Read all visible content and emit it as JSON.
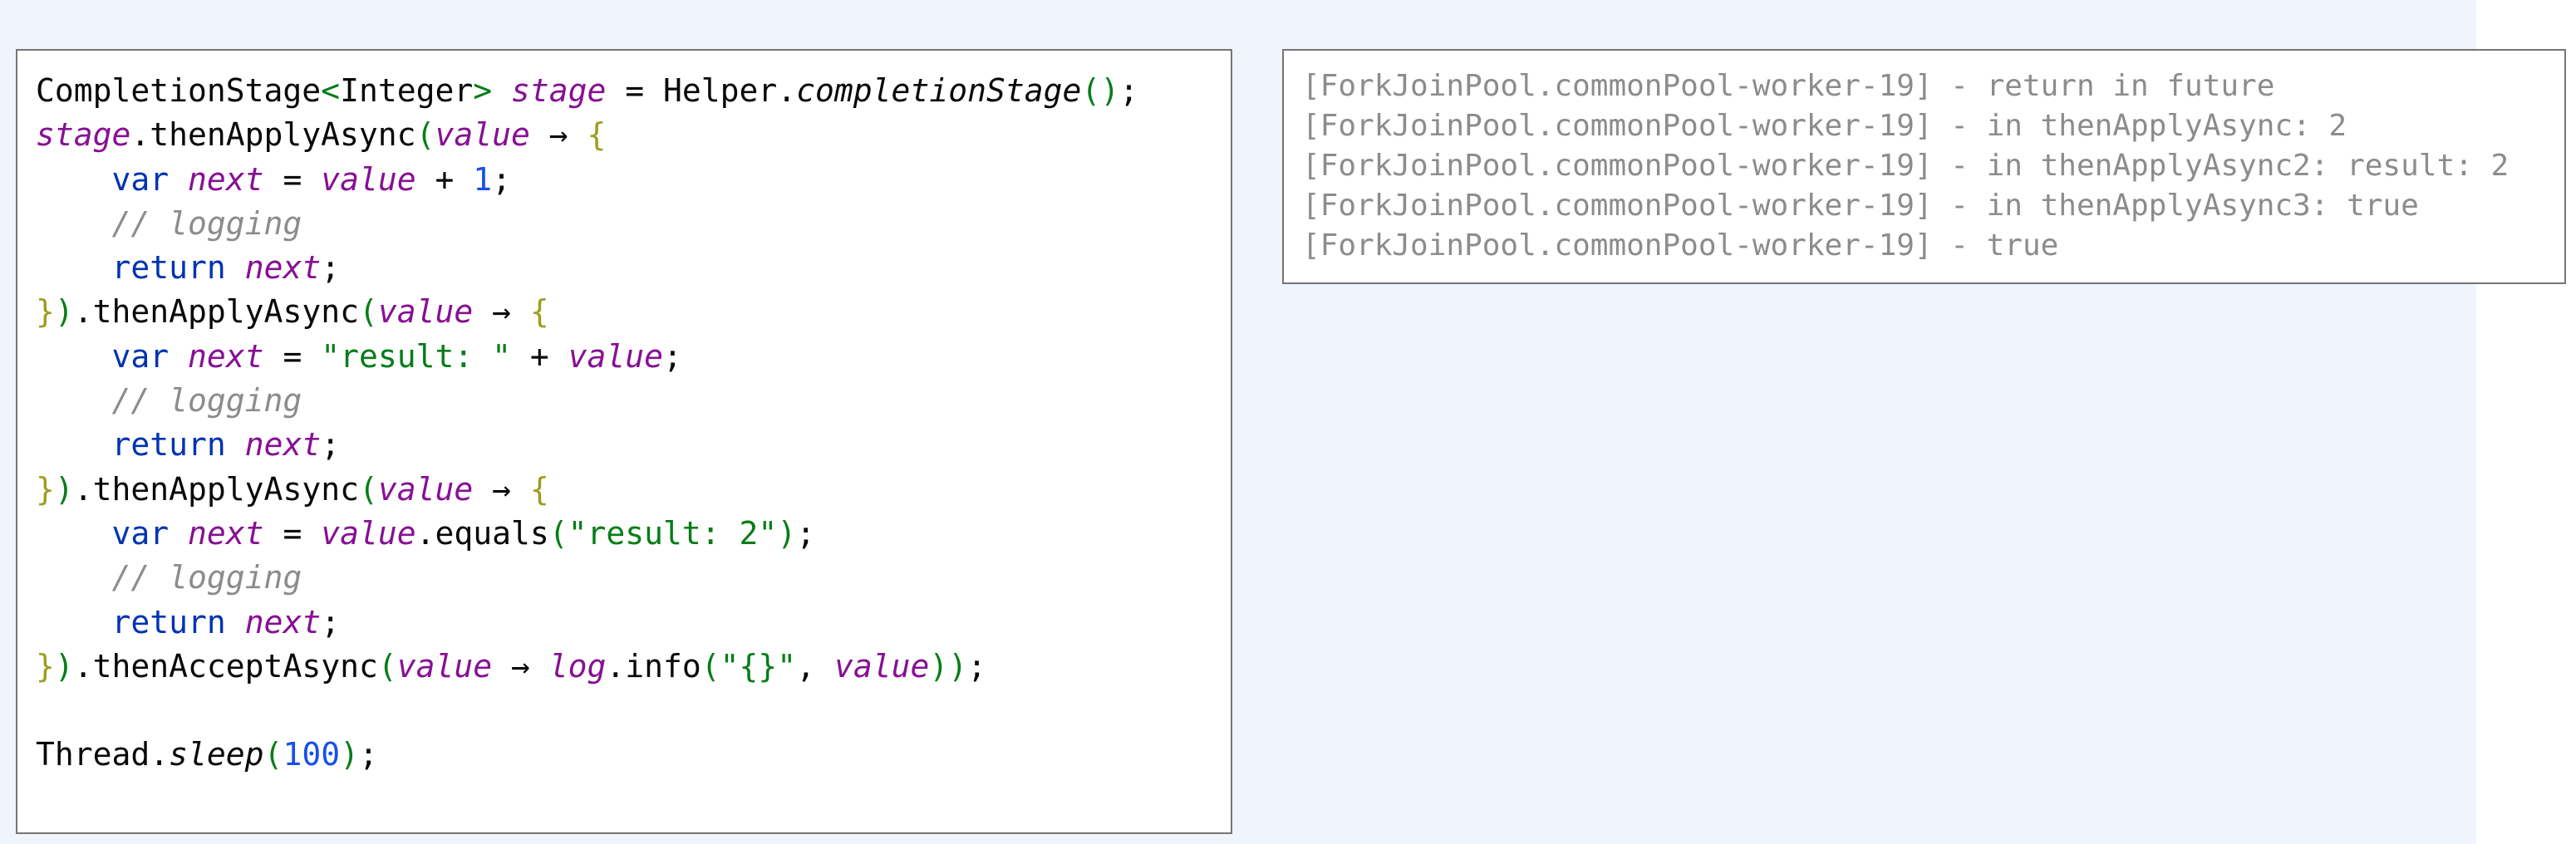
{
  "code": {
    "lines": [
      [
        {
          "t": "CompletionStage",
          "c": "plain"
        },
        {
          "t": "<",
          "c": "gen"
        },
        {
          "t": "Integer",
          "c": "plain"
        },
        {
          "t": ">",
          "c": "gen"
        },
        {
          "t": " ",
          "c": "plain"
        },
        {
          "t": "stage",
          "c": "var"
        },
        {
          "t": " = Helper.",
          "c": "plain"
        },
        {
          "t": "completionStage",
          "c": "fn-it"
        },
        {
          "t": "()",
          "c": "paren"
        },
        {
          "t": ";",
          "c": "plain"
        }
      ],
      [
        {
          "t": "stage",
          "c": "var"
        },
        {
          "t": ".thenApplyAsync",
          "c": "plain"
        },
        {
          "t": "(",
          "c": "paren"
        },
        {
          "t": "value",
          "c": "var"
        },
        {
          "t": " → ",
          "c": "plain"
        },
        {
          "t": "{",
          "c": "brace"
        }
      ],
      [
        {
          "t": "    ",
          "c": "plain"
        },
        {
          "t": "var",
          "c": "kw"
        },
        {
          "t": " ",
          "c": "plain"
        },
        {
          "t": "next",
          "c": "var"
        },
        {
          "t": " = ",
          "c": "plain"
        },
        {
          "t": "value",
          "c": "var"
        },
        {
          "t": " + ",
          "c": "plain"
        },
        {
          "t": "1",
          "c": "num"
        },
        {
          "t": ";",
          "c": "plain"
        }
      ],
      [
        {
          "t": "    ",
          "c": "plain"
        },
        {
          "t": "// logging",
          "c": "cmt"
        }
      ],
      [
        {
          "t": "    ",
          "c": "plain"
        },
        {
          "t": "return",
          "c": "kw"
        },
        {
          "t": " ",
          "c": "plain"
        },
        {
          "t": "next",
          "c": "var"
        },
        {
          "t": ";",
          "c": "plain"
        }
      ],
      [
        {
          "t": "}",
          "c": "brace"
        },
        {
          "t": ")",
          "c": "paren"
        },
        {
          "t": ".thenApplyAsync",
          "c": "plain"
        },
        {
          "t": "(",
          "c": "paren"
        },
        {
          "t": "value",
          "c": "var"
        },
        {
          "t": " → ",
          "c": "plain"
        },
        {
          "t": "{",
          "c": "brace"
        }
      ],
      [
        {
          "t": "    ",
          "c": "plain"
        },
        {
          "t": "var",
          "c": "kw"
        },
        {
          "t": " ",
          "c": "plain"
        },
        {
          "t": "next",
          "c": "var"
        },
        {
          "t": " = ",
          "c": "plain"
        },
        {
          "t": "\"result: \"",
          "c": "str"
        },
        {
          "t": " + ",
          "c": "plain"
        },
        {
          "t": "value",
          "c": "var"
        },
        {
          "t": ";",
          "c": "plain"
        }
      ],
      [
        {
          "t": "    ",
          "c": "plain"
        },
        {
          "t": "// logging",
          "c": "cmt"
        }
      ],
      [
        {
          "t": "    ",
          "c": "plain"
        },
        {
          "t": "return",
          "c": "kw"
        },
        {
          "t": " ",
          "c": "plain"
        },
        {
          "t": "next",
          "c": "var"
        },
        {
          "t": ";",
          "c": "plain"
        }
      ],
      [
        {
          "t": "}",
          "c": "brace"
        },
        {
          "t": ")",
          "c": "paren"
        },
        {
          "t": ".thenApplyAsync",
          "c": "plain"
        },
        {
          "t": "(",
          "c": "paren"
        },
        {
          "t": "value",
          "c": "var"
        },
        {
          "t": " → ",
          "c": "plain"
        },
        {
          "t": "{",
          "c": "brace"
        }
      ],
      [
        {
          "t": "    ",
          "c": "plain"
        },
        {
          "t": "var",
          "c": "kw"
        },
        {
          "t": " ",
          "c": "plain"
        },
        {
          "t": "next",
          "c": "var"
        },
        {
          "t": " = ",
          "c": "plain"
        },
        {
          "t": "value",
          "c": "var"
        },
        {
          "t": ".equals",
          "c": "plain"
        },
        {
          "t": "(",
          "c": "paren"
        },
        {
          "t": "\"result: 2\"",
          "c": "str"
        },
        {
          "t": ")",
          "c": "paren"
        },
        {
          "t": ";",
          "c": "plain"
        }
      ],
      [
        {
          "t": "    ",
          "c": "plain"
        },
        {
          "t": "// logging",
          "c": "cmt"
        }
      ],
      [
        {
          "t": "    ",
          "c": "plain"
        },
        {
          "t": "return",
          "c": "kw"
        },
        {
          "t": " ",
          "c": "plain"
        },
        {
          "t": "next",
          "c": "var"
        },
        {
          "t": ";",
          "c": "plain"
        }
      ],
      [
        {
          "t": "}",
          "c": "brace"
        },
        {
          "t": ")",
          "c": "paren"
        },
        {
          "t": ".thenAcceptAsync",
          "c": "plain"
        },
        {
          "t": "(",
          "c": "paren"
        },
        {
          "t": "value",
          "c": "var"
        },
        {
          "t": " → ",
          "c": "plain"
        },
        {
          "t": "log",
          "c": "var"
        },
        {
          "t": ".info",
          "c": "plain"
        },
        {
          "t": "(",
          "c": "paren"
        },
        {
          "t": "\"{}\"",
          "c": "str"
        },
        {
          "t": ", ",
          "c": "plain"
        },
        {
          "t": "value",
          "c": "var"
        },
        {
          "t": "))",
          "c": "paren"
        },
        {
          "t": ";",
          "c": "plain"
        }
      ],
      [],
      [
        {
          "t": "Thread.",
          "c": "plain"
        },
        {
          "t": "sleep",
          "c": "fn-it"
        },
        {
          "t": "(",
          "c": "paren"
        },
        {
          "t": "100",
          "c": "num"
        },
        {
          "t": ")",
          "c": "paren"
        },
        {
          "t": ";",
          "c": "plain"
        }
      ]
    ]
  },
  "log": {
    "lines": [
      "[ForkJoinPool.commonPool-worker-19] - return in future",
      "[ForkJoinPool.commonPool-worker-19] - in thenApplyAsync: 2",
      "[ForkJoinPool.commonPool-worker-19] - in thenApplyAsync2: result: 2",
      "[ForkJoinPool.commonPool-worker-19] - in thenApplyAsync3: true",
      "[ForkJoinPool.commonPool-worker-19] - true"
    ]
  }
}
